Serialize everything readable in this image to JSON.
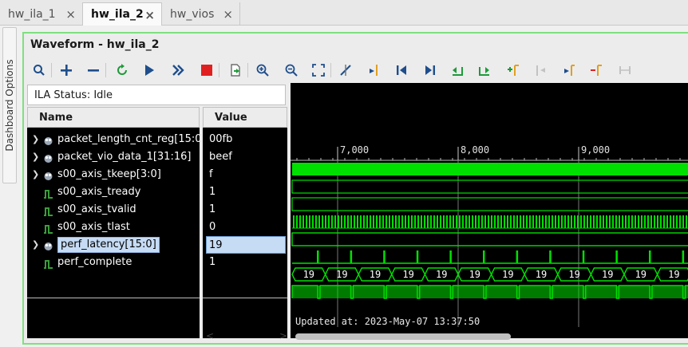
{
  "tabs": [
    {
      "label": "hw_ila_1",
      "close": "×",
      "active": false
    },
    {
      "label": "hw_ila_2",
      "close": "×",
      "active": true
    },
    {
      "label": "hw_vios",
      "close": "×",
      "active": false
    }
  ],
  "dashboard_tab": "Dashboard Options",
  "panel": {
    "title": "Waveform - hw_ila_2"
  },
  "toolbar": {
    "buttons": [
      "search-icon",
      "add-icon",
      "remove-icon",
      "reset-icon",
      "run-trigger-icon",
      "run-immediate-icon",
      "stop-icon",
      "export-icon",
      "zoom-in-icon",
      "zoom-out-icon",
      "zoom-fit-icon",
      "cursor-icon",
      "go-to-time-icon",
      "go-first-icon",
      "go-last-icon",
      "prev-transition-icon",
      "next-transition-icon",
      "add-marker-icon",
      "prev-marker-icon",
      "next-marker-icon",
      "swap-cursors-icon",
      "fix-cursor-icon"
    ]
  },
  "ila_status": "ILA Status: Idle",
  "columns": {
    "name": "Name",
    "value": "Value"
  },
  "signals": [
    {
      "name": "packet_length_cnt_reg[15:0]",
      "value": "00fb",
      "type": "bus",
      "expandable": true
    },
    {
      "name": "packet_vio_data_1[31:16]",
      "value": "beef",
      "type": "bus",
      "expandable": true
    },
    {
      "name": "s00_axis_tkeep[3:0]",
      "value": "f",
      "type": "bus",
      "expandable": true
    },
    {
      "name": "s00_axis_tready",
      "value": "1",
      "type": "bit",
      "expandable": false
    },
    {
      "name": "s00_axis_tvalid",
      "value": "1",
      "type": "bit",
      "expandable": false
    },
    {
      "name": "s00_axis_tlast",
      "value": "0",
      "type": "bit",
      "expandable": false
    },
    {
      "name": "perf_latency[15:0]",
      "value": "19",
      "type": "bus",
      "expandable": true,
      "selected": true
    },
    {
      "name": "perf_complete",
      "value": "1",
      "type": "bit",
      "expandable": false
    }
  ],
  "timeline": {
    "ticks": [
      "7,000",
      "8,000",
      "9,000"
    ]
  },
  "latency_bus_values": [
    "19",
    "19",
    "19",
    "19",
    "19",
    "19",
    "19",
    "19",
    "19",
    "19",
    "19",
    "19"
  ],
  "updated_at": "Updated at: 2023-May-07 13:37:50",
  "scroll": {
    "left": "<",
    "right": ">"
  },
  "colors": {
    "wave": "#00e000",
    "highlight": "#c6dcf5",
    "panel_border": "#7fe07f",
    "stop": "#e02020"
  }
}
